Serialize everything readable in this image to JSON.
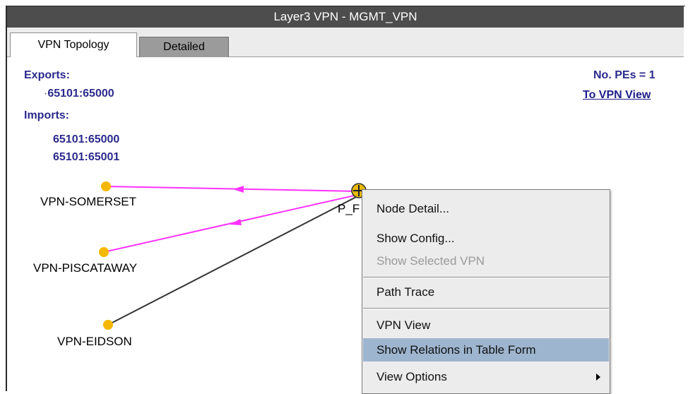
{
  "window": {
    "title": "Layer3 VPN - MGMT_VPN"
  },
  "tabs": [
    {
      "label": "VPN Topology",
      "active": true
    },
    {
      "label": "Detailed",
      "active": false
    }
  ],
  "exports": {
    "heading": "Exports:",
    "values": [
      "65101:65000"
    ]
  },
  "imports": {
    "heading": "Imports:",
    "values": [
      "65101:65000",
      "65101:65001"
    ]
  },
  "summary": {
    "pe_count": "No. PEs = 1",
    "vpn_view_link": "To VPN View"
  },
  "topology": {
    "nodes": [
      {
        "label": "VPN-SOMERSET",
        "color": "#f5b800"
      },
      {
        "label": "VPN-PISCATAWAY",
        "color": "#f5b800"
      },
      {
        "label": "VPN-EIDSON",
        "color": "#f5b800"
      },
      {
        "label": "P_F",
        "icon": "router-icon"
      }
    ],
    "link_colors": {
      "vpn_route": "#ff33ff",
      "physical": "#333333"
    }
  },
  "context_menu": {
    "items": [
      {
        "label": "Node Detail...",
        "enabled": true
      },
      {
        "label": "Show Config...",
        "enabled": true
      },
      {
        "label": "Show Selected VPN",
        "enabled": false
      },
      {
        "label": "Path Trace",
        "enabled": true
      },
      {
        "label": "VPN View",
        "enabled": true
      },
      {
        "label": "Show Relations in Table Form",
        "enabled": true,
        "highlighted": true
      },
      {
        "label": "View Options",
        "enabled": true,
        "submenu": true
      }
    ],
    "highlight_color": "#9eb5cf"
  }
}
